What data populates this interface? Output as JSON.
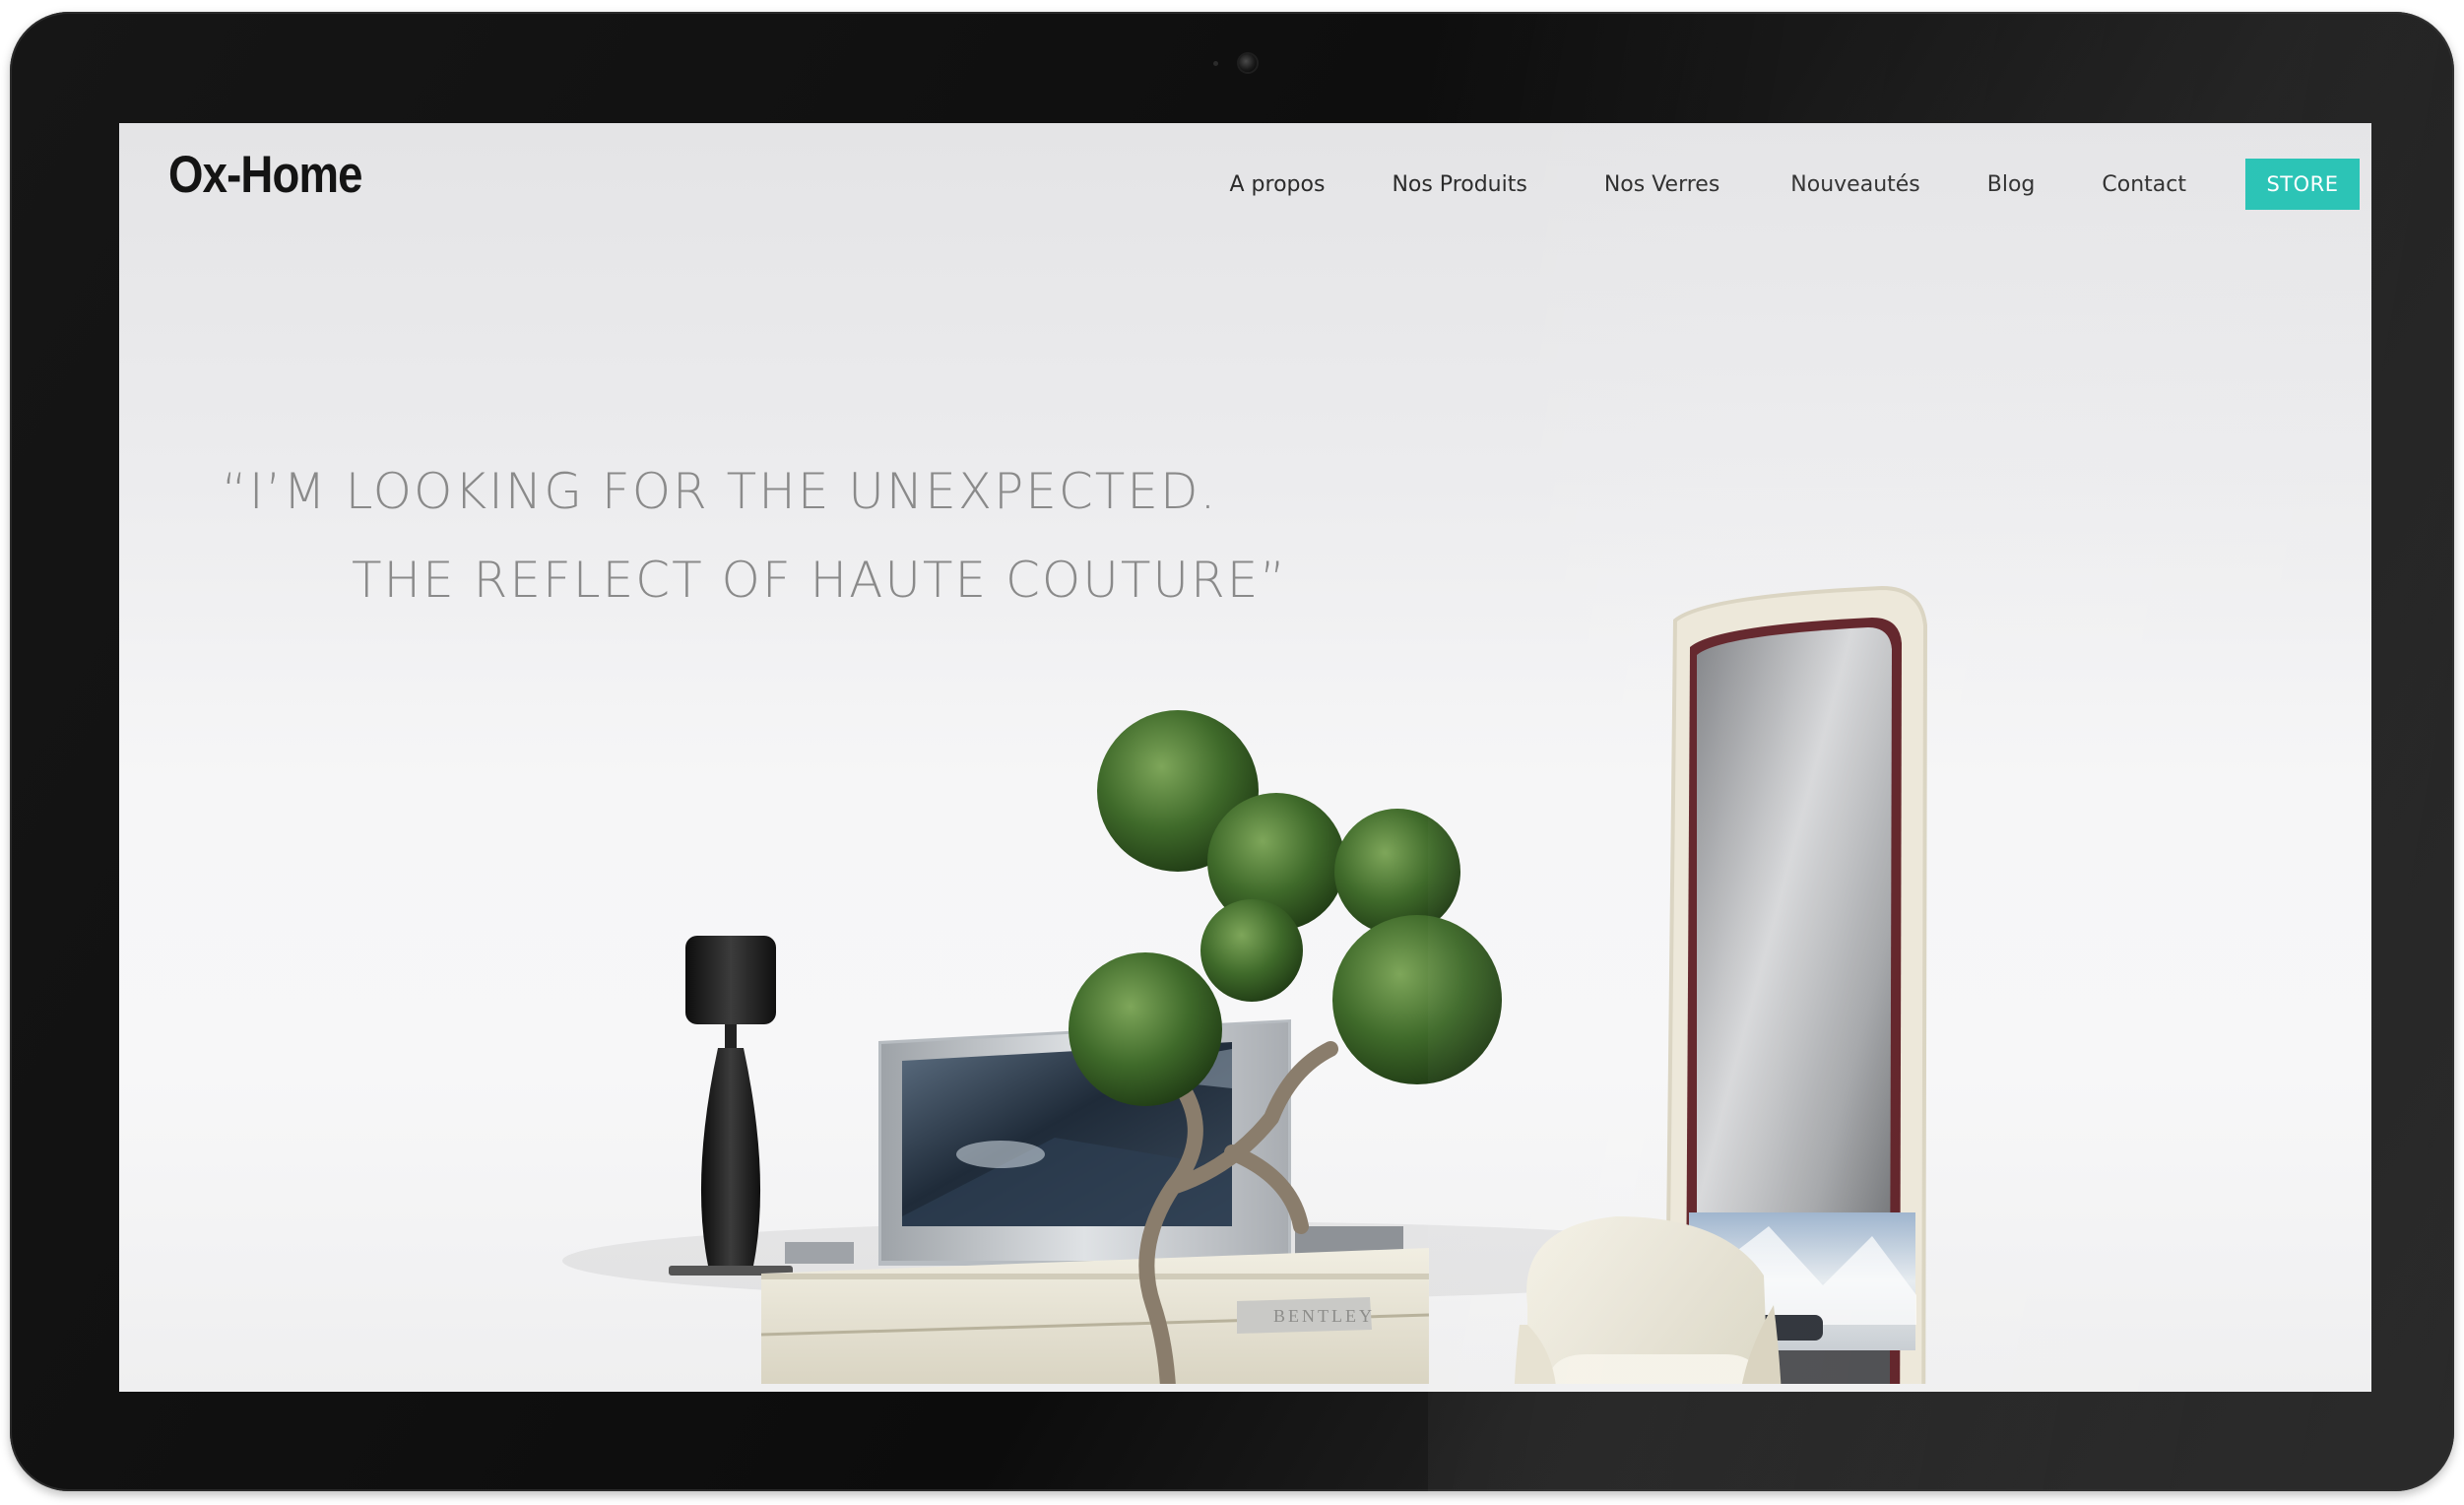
{
  "brand": {
    "logo": "Ox-Home"
  },
  "nav": {
    "items": [
      {
        "label": "A propos"
      },
      {
        "label": "Nos Produits"
      },
      {
        "label": "Nos Verres"
      },
      {
        "label": "Nouveautés"
      },
      {
        "label": "Blog"
      },
      {
        "label": "Contact"
      }
    ],
    "store_label": "STORE"
  },
  "hero": {
    "quote_line_1": "“I’M LOOKING FOR THE UNEXPECTED.",
    "quote_line_2": "THE REFLECT OF HAUTE COUTURE”",
    "sideboard_badge": "BENTLEY"
  },
  "colors": {
    "accent": "#25c2b4",
    "bezel": "#111111",
    "screen_bg": "#f2f2f3",
    "quote_text": "#8a8a8a"
  },
  "icons": {
    "camera": "webcam-icon"
  }
}
